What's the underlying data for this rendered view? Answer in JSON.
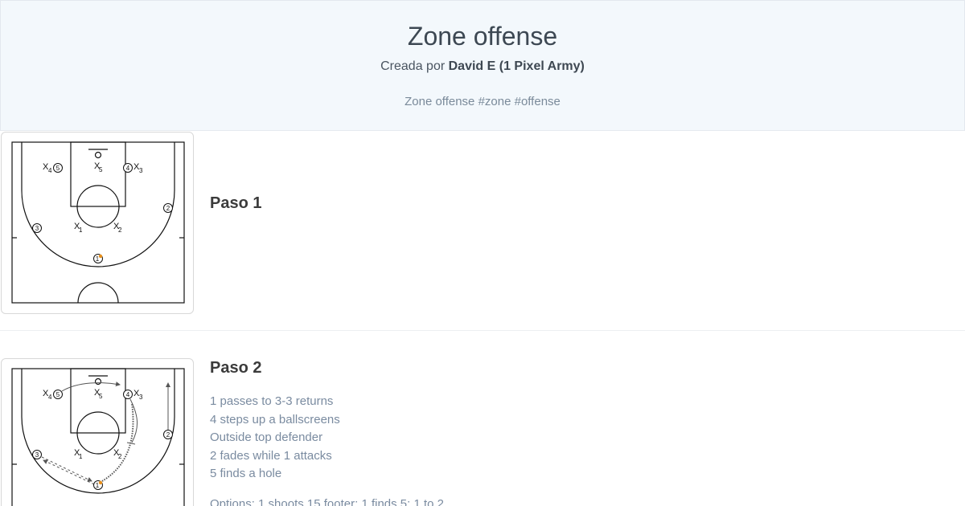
{
  "header": {
    "title": "Zone offense",
    "created_by_prefix": "Creada por ",
    "author": "David E (1 Pixel Army)",
    "tags": "Zone offense #zone #offense"
  },
  "steps": [
    {
      "title": "Paso 1"
    },
    {
      "title": "Paso 2",
      "lines": [
        "1 passes to 3-3 returns",
        "4 steps up a ballscreens",
        "Outside top defender",
        "2 fades while 1 attacks",
        "5 finds a hole"
      ],
      "options": "Options: 1 shoots 15 footer; 1 finds 5; 1 to 2"
    }
  ],
  "players": {
    "offense": [
      "1",
      "2",
      "3",
      "4",
      "5"
    ],
    "defense": [
      "1",
      "2",
      "3",
      "4",
      "5"
    ],
    "defense_symbol": "X"
  },
  "colors": {
    "header_bg": "#f3f8fc",
    "ball": "#e8901c",
    "muted_text": "#7a8ba0"
  }
}
